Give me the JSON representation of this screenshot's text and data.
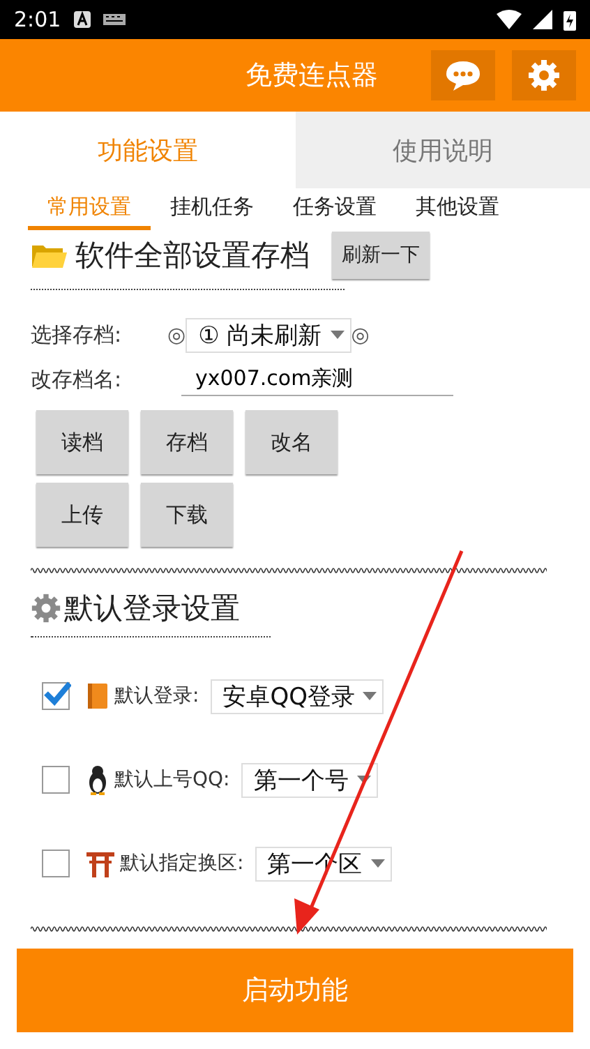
{
  "status_bar": {
    "time": "2:01"
  },
  "app_bar": {
    "title": "免费连点器"
  },
  "tabs": [
    {
      "label": "功能设置",
      "selected": true
    },
    {
      "label": "使用说明",
      "selected": false
    }
  ],
  "sub_tabs": [
    {
      "label": "常用设置",
      "selected": true
    },
    {
      "label": "挂机任务",
      "selected": false
    },
    {
      "label": "任务设置",
      "selected": false
    },
    {
      "label": "其他设置",
      "selected": false
    }
  ],
  "archive_section": {
    "title": "软件全部设置存档",
    "refresh_button": "刷新一下",
    "select_label": "选择存档:",
    "select_marks": [
      "◎",
      "◎"
    ],
    "select_value": "① 尚未刷新",
    "rename_label": "改存档名:",
    "rename_value": "yx007.com亲测",
    "buttons": [
      [
        "读档",
        "存档",
        "改名"
      ],
      [
        "上传",
        "下载"
      ]
    ]
  },
  "login_section": {
    "title": "默认登录设置",
    "options": [
      {
        "checked": true,
        "label": "默认登录:",
        "value": "安卓QQ登录"
      },
      {
        "checked": false,
        "label": "默认上号QQ:",
        "value": "第一个号"
      },
      {
        "checked": false,
        "label": "默认指定换区:",
        "value": "第一个区"
      }
    ]
  },
  "start_button": "启动功能"
}
